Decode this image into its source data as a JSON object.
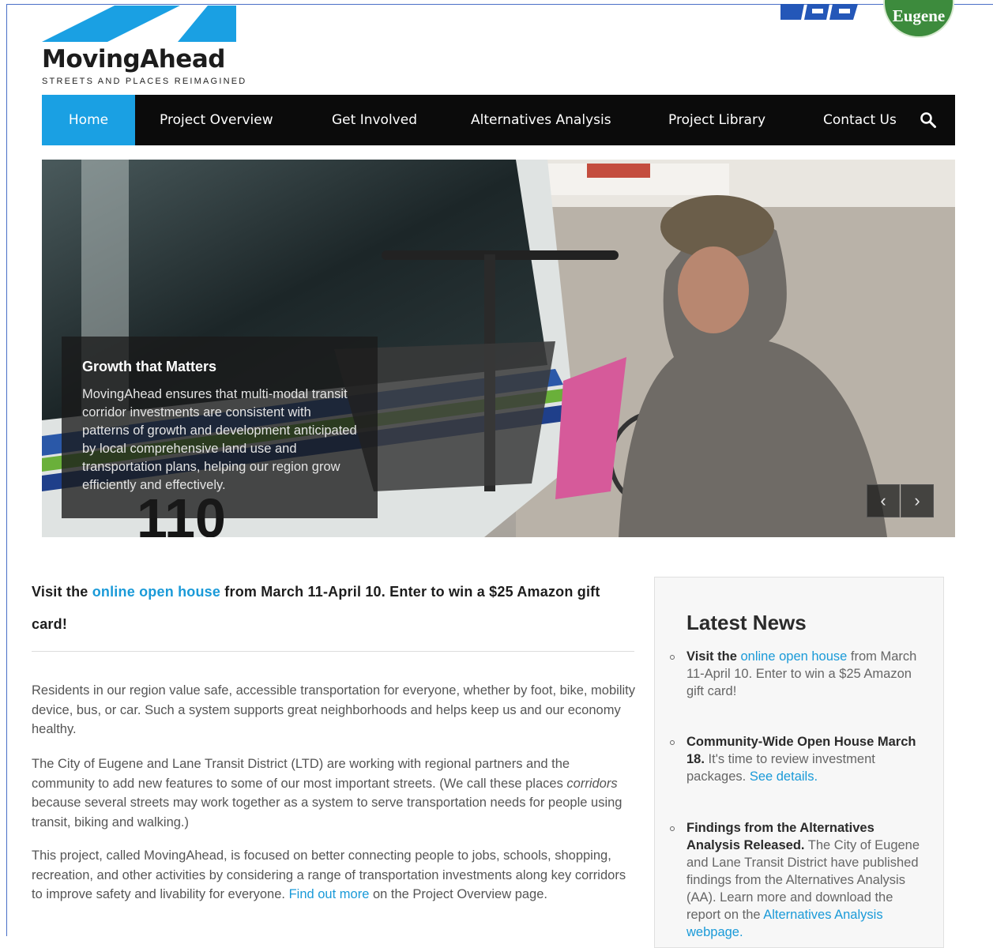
{
  "logo": {
    "name": "MovingAhead",
    "tagline": "STREETS AND PLACES REIMAGINED"
  },
  "partners": {
    "eugene": "Eugene"
  },
  "nav": {
    "items": [
      "Home",
      "Project Overview",
      "Get Involved",
      "Alternatives Analysis",
      "Project Library",
      "Contact Us"
    ],
    "active": "Home"
  },
  "hero": {
    "caption_title": "Growth that Matters",
    "caption_text": "MovingAhead ensures that multi-modal transit corridor investments are consistent with patterns of growth and development anticipated by local comprehensive land use and transportation plans, helping our region grow efficiently and effectively.",
    "prev": "‹",
    "next": "›"
  },
  "announcement": {
    "pre": "Visit the ",
    "link": "online open house",
    "post": " from March 11-April 10. Enter to win a $25 Amazon gift card!"
  },
  "body": {
    "p1": "Residents in our region value safe, accessible transportation for everyone, whether by foot, bike, mobility device, bus, or car. Such a system supports great neighborhoods and helps keep us and our economy healthy.",
    "p2_a": "The City of Eugene and Lane Transit District (LTD) are working with regional partners and the community to add new features to some of our most important streets. (We call these places ",
    "p2_em": "corridors",
    "p2_b": " because several streets may work together as a system to serve transportation needs for people using transit, biking and walking.)",
    "p3_a": "This project, called MovingAhead, is focused on better connecting people to jobs, schools, shopping, recreation, and other activities by considering a range of transportation investments along key corridors to improve safety and livability for everyone. ",
    "p3_link": "Find out more",
    "p3_b": " on the Project Overview page."
  },
  "sidebar": {
    "title": "Latest News",
    "news": [
      {
        "bold_pre": "Visit the ",
        "link": "online open house",
        "text": " from March 11-April 10. Enter to win a $25 Amazon gift card!"
      },
      {
        "bold": "Community-Wide Open House March 18.",
        "text": " It's time to review investment packages. ",
        "link": "See details."
      },
      {
        "bold": "Findings from the Alternatives Analysis Released.",
        "text": " The City of Eugene and Lane Transit District have published findings from the Alternatives Analysis (AA). Learn more and download the report on the ",
        "link": "Alternatives Analysis webpage."
      }
    ]
  }
}
